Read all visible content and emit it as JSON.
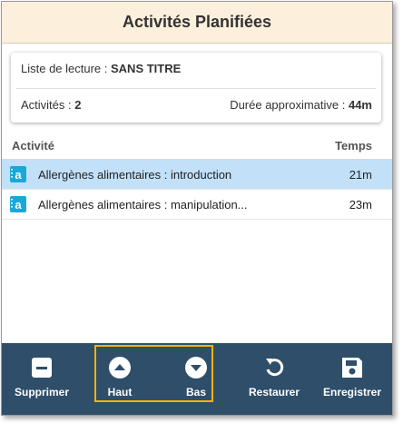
{
  "header": {
    "title": "Activités Planifiées"
  },
  "summary": {
    "playlist_label": "Liste de lecture : ",
    "playlist_name": "SANS TITRE",
    "activities_label": "Activités : ",
    "activities_count": "2",
    "duration_label": "Durée approximative : ",
    "duration_value": "44m"
  },
  "columns": {
    "activity": "Activité",
    "time": "Temps"
  },
  "items": [
    {
      "label": "Allergènes alimentaires : introduction",
      "time": "21m",
      "selected": true,
      "icon": "activity-icon"
    },
    {
      "label": "Allergènes alimentaires : manipulation...",
      "time": "23m",
      "selected": false,
      "icon": "activity-icon"
    }
  ],
  "toolbar": {
    "delete_label": "Supprimer",
    "up_label": "Haut",
    "down_label": "Bas",
    "restore_label": "Restaurer",
    "save_label": "Enregistrer"
  },
  "colors": {
    "header_bg": "#fcefdc",
    "selected_row": "#c2e0f8",
    "toolbar_bg": "#2f4e6a",
    "highlight": "#f5b400",
    "activity_icon": "#1aa8d8"
  }
}
